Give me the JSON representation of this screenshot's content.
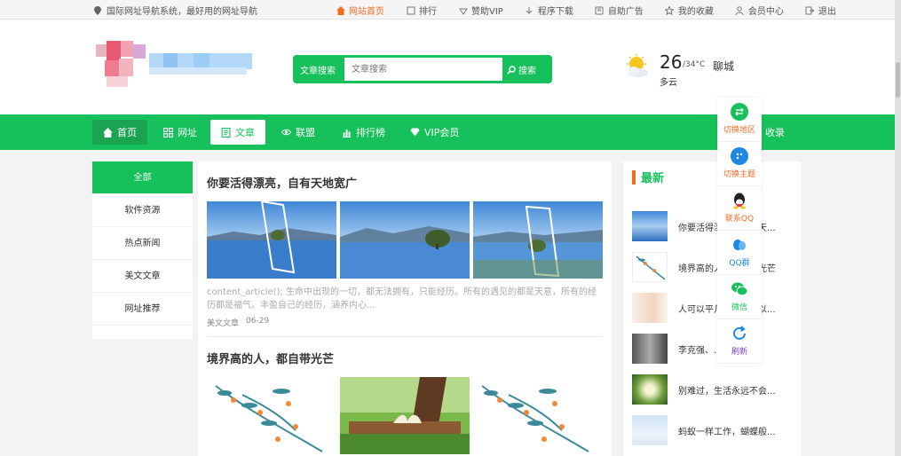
{
  "topbar": {
    "slogan": "国际网址导航系统，最好用的网址导航",
    "links": [
      {
        "label": "网站首页",
        "icon": "home-icon",
        "active": true
      },
      {
        "label": "排行",
        "icon": "rank-icon",
        "active": false
      },
      {
        "label": "赞助VIP",
        "icon": "vip-icon",
        "active": false
      },
      {
        "label": "程序下载",
        "icon": "download-icon",
        "active": false
      },
      {
        "label": "自助广告",
        "icon": "ad-icon",
        "active": false
      },
      {
        "label": "我的收藏",
        "icon": "star-icon",
        "active": false
      },
      {
        "label": "会员中心",
        "icon": "user-icon",
        "active": false
      },
      {
        "label": "退出",
        "icon": "logout-icon",
        "active": false
      }
    ]
  },
  "search": {
    "category_label": "文章搜索",
    "placeholder": "文章搜索",
    "button_label": "搜索"
  },
  "weather": {
    "temp": "26",
    "range": "/34°C",
    "condition": "多云",
    "city": "聊城"
  },
  "nav": {
    "items": [
      {
        "label": "首页",
        "icon": "home-icon"
      },
      {
        "label": "网址",
        "icon": "grid-icon"
      },
      {
        "label": "文章",
        "icon": "document-icon"
      },
      {
        "label": "联盟",
        "icon": "eye-icon"
      },
      {
        "label": "排行榜",
        "icon": "chart-icon"
      },
      {
        "label": "VIP会员",
        "icon": "diamond-icon"
      }
    ],
    "right_label": "收录"
  },
  "categories": [
    "全部",
    "软件资源",
    "热点新闻",
    "美文文章",
    "网址推荐"
  ],
  "articles": [
    {
      "title": "你要活得漂亮，自有天地宽广",
      "excerpt": "content_article();                    生命中出现的一切，都无法拥有，只能经历。所有的遇见的都是天意，所有的经历都是福气。丰盈自己的经历，涵养内心...",
      "category": "美文文章",
      "date": "06-29"
    },
    {
      "title": "境界高的人，都自带光芒"
    }
  ],
  "latest": {
    "title": "最新",
    "items": [
      "你要活得漂亮，自有天...",
      "境界高的人，都自带光芒",
      "人可以平凡，但不可以...",
      "李克强、...的红毯...",
      "别难过，生活永远不会...",
      "蚂蚁一样工作，蝴蝶般..."
    ]
  },
  "float_tools": [
    {
      "label": "切换地区",
      "icon": "swap-icon",
      "color": "#16c05a",
      "label_color": "#f36d21"
    },
    {
      "label": "切换主题",
      "icon": "palette-icon",
      "color": "#1e88e5",
      "label_color": "#f36d21"
    },
    {
      "label": "联系QQ",
      "icon": "qq-icon",
      "color": "#222222",
      "label_color": "#f36d21"
    },
    {
      "label": "QQ群",
      "icon": "qq-group-icon",
      "color": "#1e88e5",
      "label_color": "#1e88e5"
    },
    {
      "label": "微信",
      "icon": "wechat-icon",
      "color": "#16c05a",
      "label_color": "#16c05a"
    },
    {
      "label": "刷新",
      "icon": "refresh-icon",
      "color": "#1e88e5",
      "label_color": "#7b3fc4"
    }
  ],
  "colors": {
    "accent": "#16c05a",
    "orange": "#f36d21"
  }
}
